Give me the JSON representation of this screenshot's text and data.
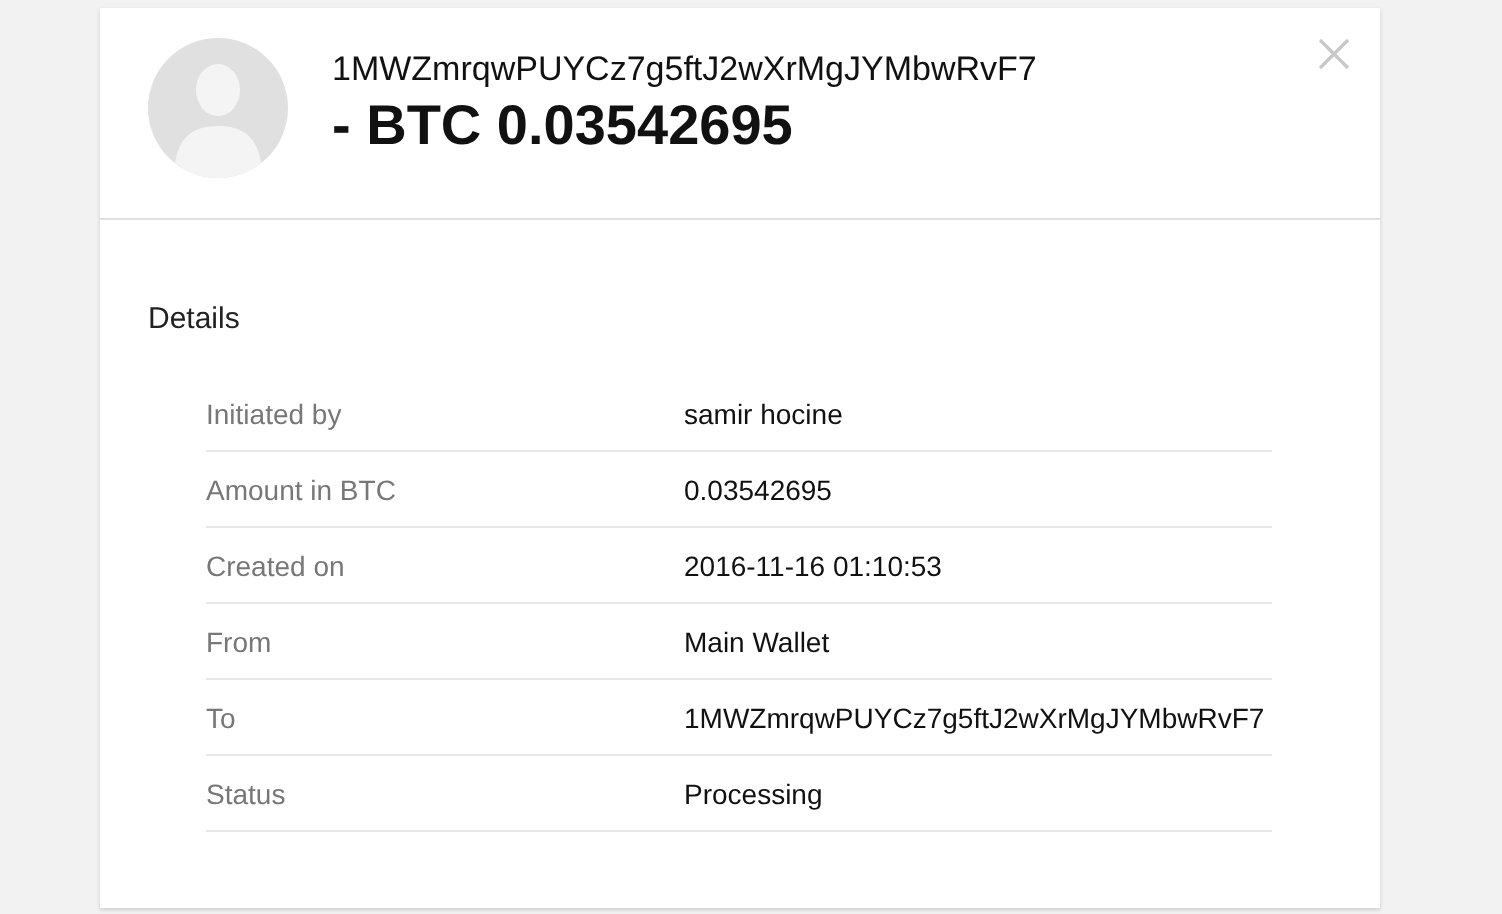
{
  "header": {
    "address": "1MWZmrqwPUYCz7g5ftJ2wXrMgJYMbwRvF7",
    "amount": "- BTC 0.03542695"
  },
  "details": {
    "title": "Details",
    "rows": [
      {
        "label": "Initiated by",
        "value": "samir hocine"
      },
      {
        "label": "Amount in BTC",
        "value": "0.03542695"
      },
      {
        "label": "Created on",
        "value": "2016-11-16 01:10:53"
      },
      {
        "label": "From",
        "value": "Main Wallet"
      },
      {
        "label": "To",
        "value": "1MWZmrqwPUYCz7g5ftJ2wXrMgJYMbwRvF7"
      },
      {
        "label": "Status",
        "value": "Processing"
      }
    ]
  }
}
